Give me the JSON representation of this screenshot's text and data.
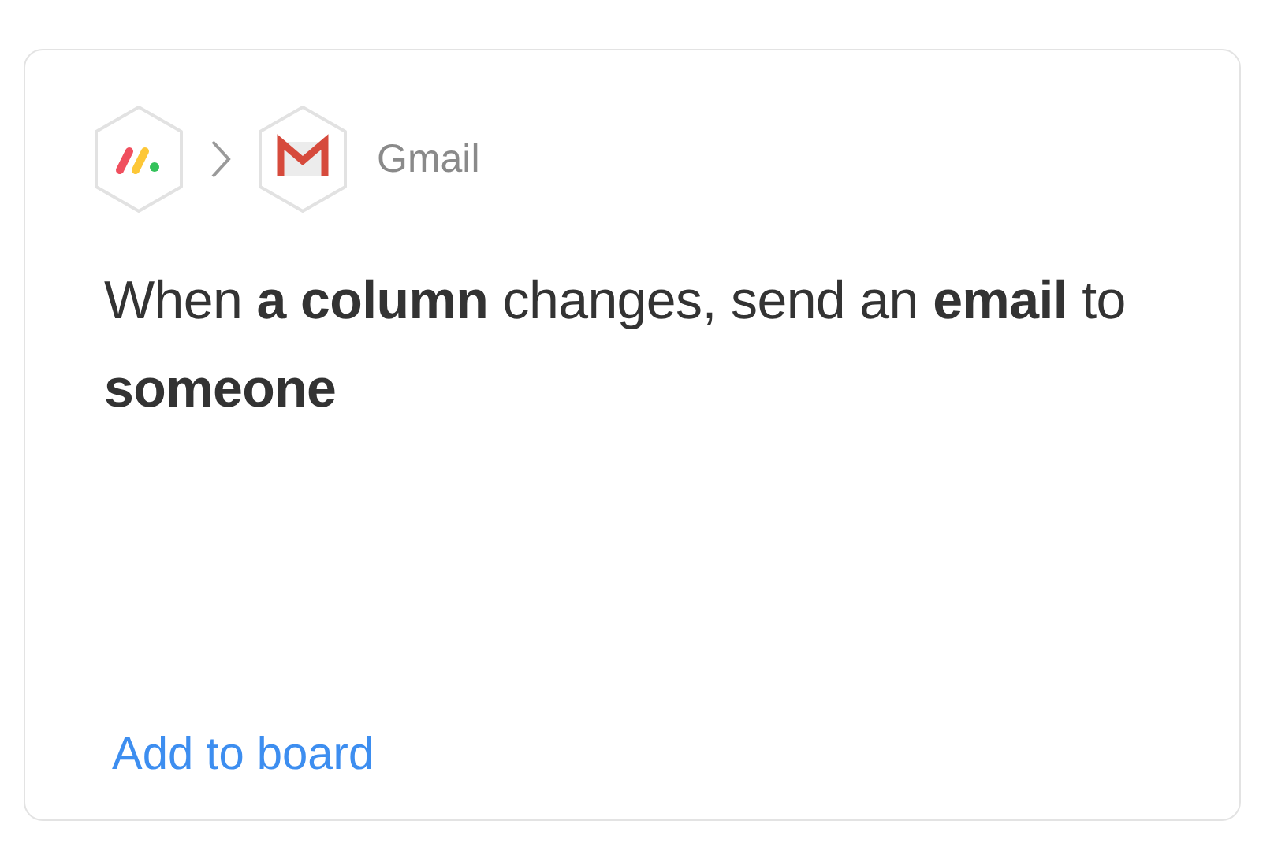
{
  "recipe": {
    "app_name": "Gmail",
    "description": "When **a column** changes, send an **email** to **someone**",
    "action": "Add to board"
  }
}
